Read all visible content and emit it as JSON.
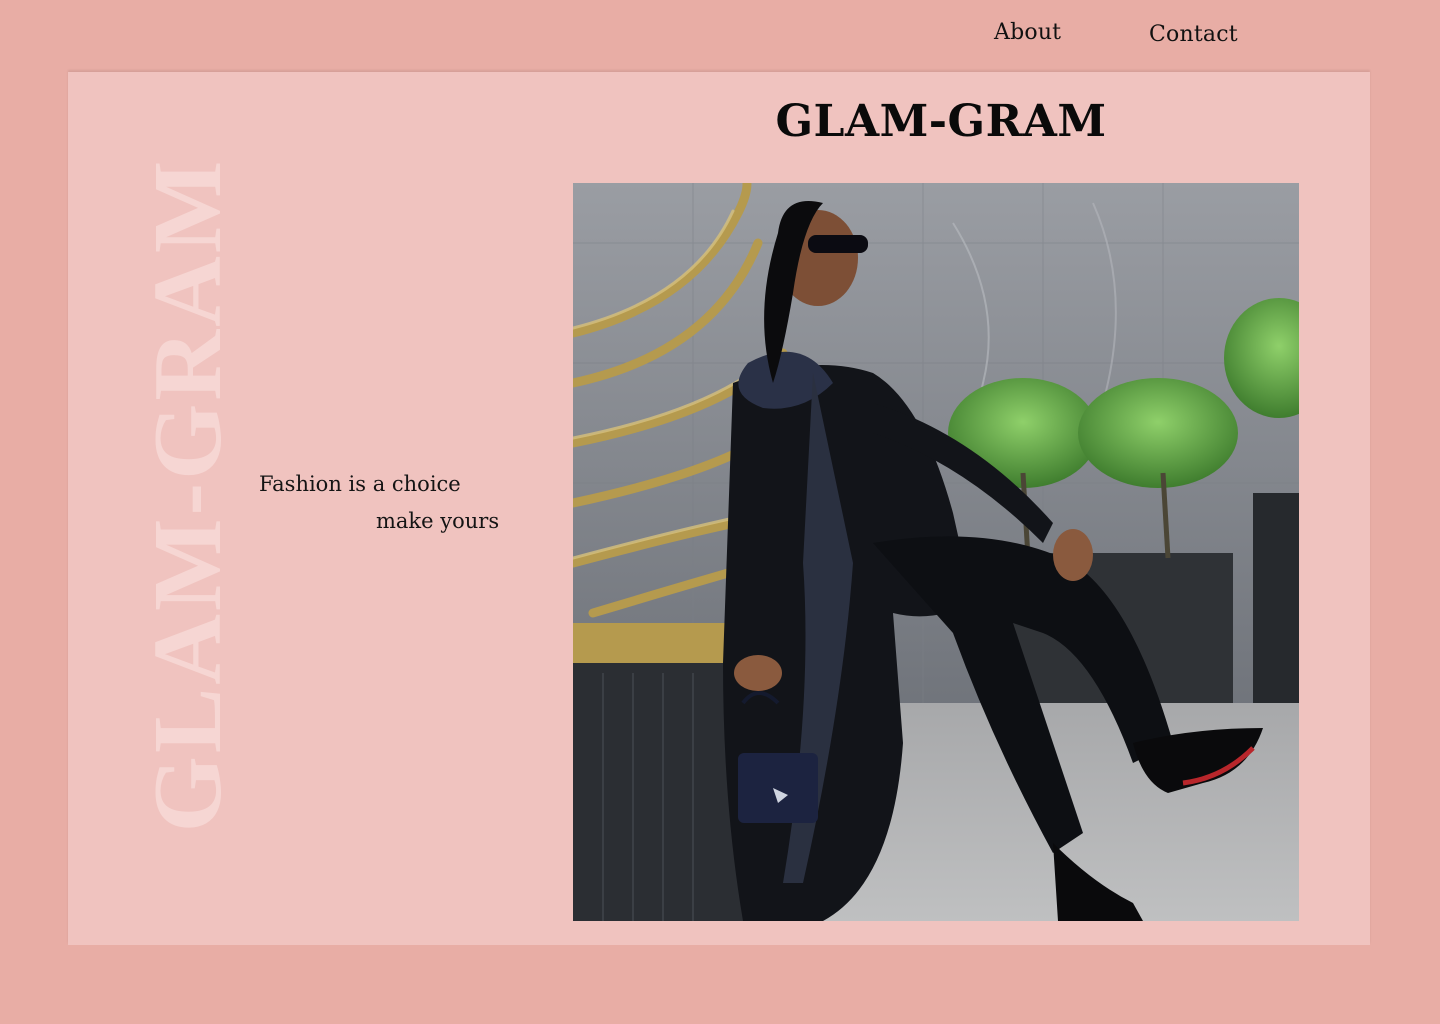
{
  "nav": {
    "about": "About",
    "contact": "Contact"
  },
  "hero": {
    "title": "GLAM-GRAM",
    "vertical_title": "GLAM-GRAM",
    "tagline_line1": "Fashion is a choice",
    "tagline_line2": "make yours"
  },
  "colors": {
    "page_background": "#e8ada5",
    "panel_background": "#f0c3bf",
    "watermark_text": "#f6d6d3",
    "text": "#111111"
  }
}
